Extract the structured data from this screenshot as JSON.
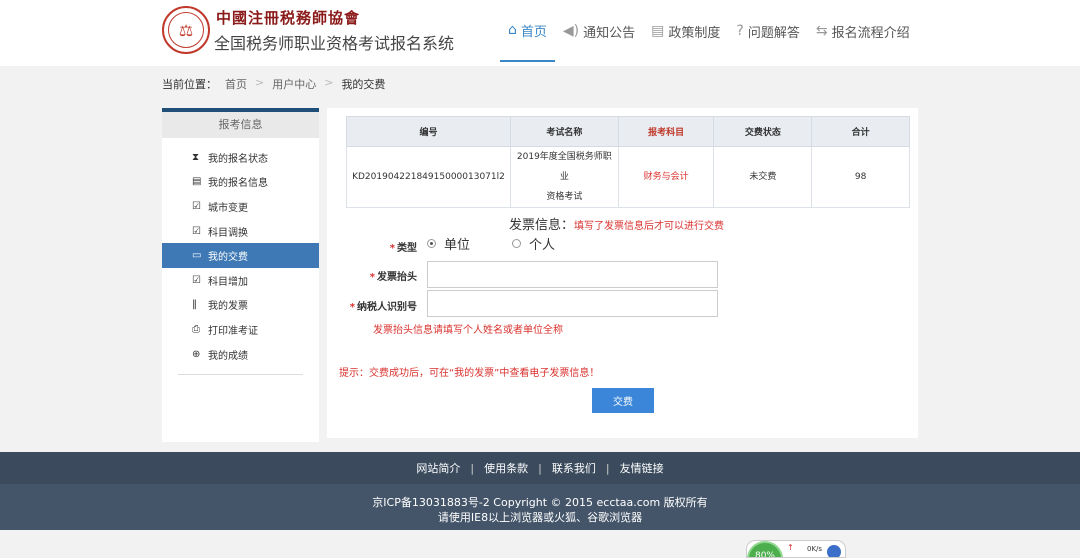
{
  "header": {
    "org_name": "中國注冊税務師協會",
    "system_name": "全国税务师职业资格考试报名系统",
    "nav": [
      {
        "label": "首页",
        "icon": "home-icon",
        "active": true
      },
      {
        "label": "通知公告",
        "icon": "speaker-icon"
      },
      {
        "label": "政策制度",
        "icon": "document-icon"
      },
      {
        "label": "问题解答",
        "icon": "question-icon"
      },
      {
        "label": "报名流程介绍",
        "icon": "flow-icon"
      }
    ]
  },
  "breadcrumb": {
    "prefix": "当前位置：",
    "items": [
      "首页",
      "用户中心",
      "我的交费"
    ],
    "separator": ">"
  },
  "sidebar": {
    "title": "报考信息",
    "items": [
      {
        "label": "我的报名状态",
        "icon": "hourglass-icon"
      },
      {
        "label": "我的报名信息",
        "icon": "list-icon"
      },
      {
        "label": "城市变更",
        "icon": "edit-icon"
      },
      {
        "label": "科目调换",
        "icon": "edit-icon"
      },
      {
        "label": "我的交费",
        "icon": "card-icon",
        "active": true
      },
      {
        "label": "科目增加",
        "icon": "edit-icon"
      },
      {
        "label": "我的发票",
        "icon": "barcode-icon"
      },
      {
        "label": "打印准考证",
        "icon": "print-icon"
      },
      {
        "label": "我的成绩",
        "icon": "zoom-icon"
      }
    ]
  },
  "fee_table": {
    "headers": [
      "编号",
      "考试名称",
      "报考科目",
      "交费状态",
      "合计"
    ],
    "rows": [
      {
        "id": "KD20190422184915000013071l2",
        "exam_name_line1": "2019年度全国税务师职业",
        "exam_name_line2": "资格考试",
        "subject": "财务与会计",
        "status": "未交费",
        "total": "98"
      }
    ]
  },
  "invoice": {
    "title": "发票信息：",
    "hint": "填写了发票信息后才可以进行交费",
    "type_label": "类型",
    "type_options": [
      "单位",
      "个人"
    ],
    "type_selected": "单位",
    "header_label": "发票抬头",
    "header_value": "",
    "taxid_label": "纳税人识别号",
    "taxid_value": "",
    "field_note": "发票抬头信息请填写个人姓名或者单位全称",
    "tip": "提示：交费成功后，可在“我的发票”中查看电子发票信息！",
    "pay_label": "交费",
    "required_mark": "*"
  },
  "footer": {
    "links": [
      "网站简介",
      "使用条款",
      "联系我们",
      "友情链接"
    ],
    "copyright": "京ICP备13031883号-2 Copyright © 2015 ecctaa.com 版权所有",
    "browser_note": "请使用IE8以上浏览器或火狐、谷歌浏览器"
  },
  "speed_widget": {
    "percent": "80%",
    "rate": "0K/s"
  },
  "colors": {
    "accent": "#3b86c6",
    "sidebar_active": "#3e79b5",
    "footer": "#3b4b5d",
    "warning": "#d9322e"
  }
}
